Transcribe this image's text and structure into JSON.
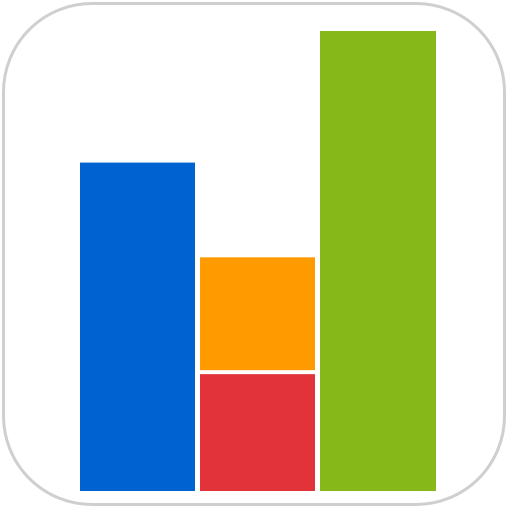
{
  "icon": {
    "name": "bar-chart-app-icon",
    "frame_color": "#cfcfcf",
    "background_color": "#ffffff"
  },
  "graphic": {
    "baseline_value": 0,
    "max_value": 100,
    "bars": [
      {
        "key": "blue",
        "color": "#0062d1",
        "value": 71.4
      },
      {
        "key": "middle-red",
        "color": "#e2323a",
        "value": 25.4
      },
      {
        "key": "middle-orange",
        "color": "#ff9b00",
        "value": 50.8,
        "stacked_on": "middle-red"
      },
      {
        "key": "green",
        "color": "#86b81a",
        "value": 100
      }
    ]
  }
}
